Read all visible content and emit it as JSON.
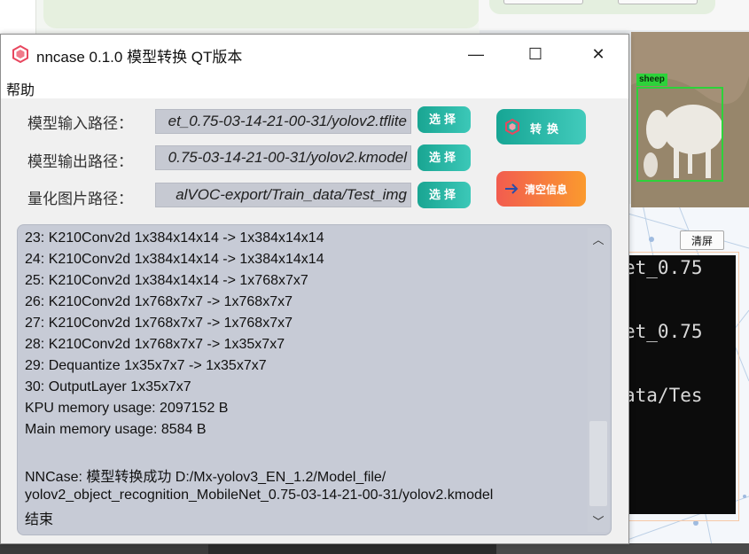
{
  "window": {
    "title": "nncase 0.1.0 模型转换 QT版本",
    "minimize_glyph": "—",
    "maximize_glyph": "☐",
    "close_glyph": "✕"
  },
  "menu": {
    "help_label": "帮助"
  },
  "form": {
    "rows": [
      {
        "label": "模型输入路径：",
        "value": "et_0.75-03-14-21-00-31/yolov2.tflite",
        "button": "选择"
      },
      {
        "label": "模型输出路径：",
        "value": "0.75-03-14-21-00-31/yolov2.kmodel",
        "button": "选择"
      },
      {
        "label": "量化图片路径：",
        "value": "alVOC-export/Train_data/Test_img",
        "button": "选择"
      }
    ]
  },
  "actions": {
    "convert_label": "转换",
    "clear_label": "清空信息"
  },
  "log": {
    "lines": [
      "23: K210Conv2d 1x384x14x14 -> 1x384x14x14",
      "24: K210Conv2d 1x384x14x14 -> 1x384x14x14",
      "25: K210Conv2d 1x384x14x14 -> 1x768x7x7",
      "26: K210Conv2d 1x768x7x7 -> 1x768x7x7",
      "27: K210Conv2d 1x768x7x7 -> 1x768x7x7",
      "28: K210Conv2d 1x768x7x7 -> 1x35x7x7",
      "29: Dequantize 1x35x7x7 -> 1x35x7x7",
      "30: OutputLayer 1x35x7x7",
      "KPU memory usage: 2097152 B",
      "Main memory usage: 8584 B",
      "",
      "NNCase: 模型转换成功  D:/Mx-yolov3_EN_1.2/Model_file/",
      "yolov2_object_recognition_MobileNet_0.75-03-14-21-00-31/yolov2.kmodel",
      "结束"
    ],
    "scroll_up_glyph": "︿",
    "scroll_down_glyph": "﹀"
  },
  "background": {
    "detection_label": "sheep",
    "clear_screen_label": "清屏",
    "terminal_lines": [
      "et_0.75",
      "et_0.75",
      "ata/Tes"
    ]
  },
  "colors": {
    "select_button": "#19a592",
    "convert_button": "#16a594",
    "clear_button": "#f25c4f",
    "log_background": "#c7cbd6",
    "detection_box": "#2dd23a"
  }
}
